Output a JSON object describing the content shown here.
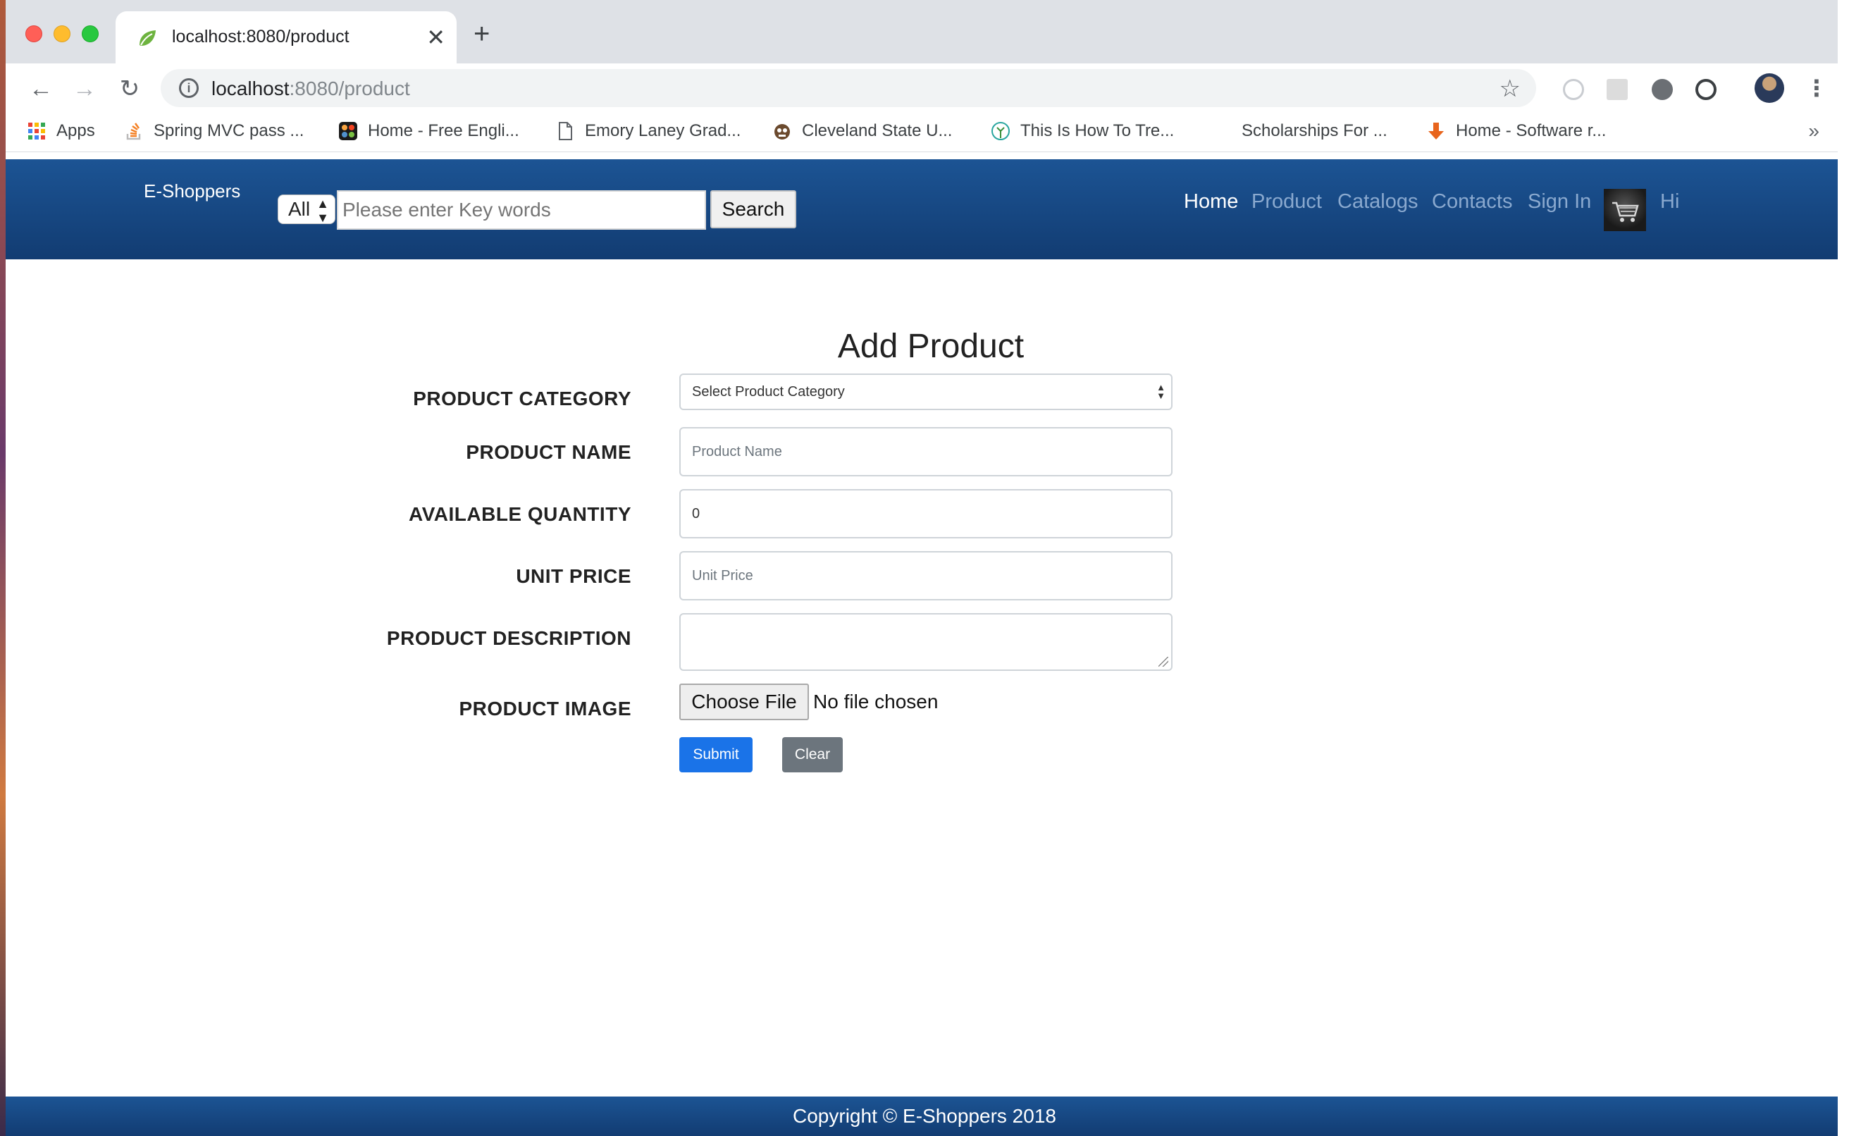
{
  "browser": {
    "tab_title": "localhost:8080/product",
    "url_host": "localhost",
    "url_path": ":8080/product",
    "bookmarks": [
      {
        "label": "Apps",
        "icon": "apps-grid-icon"
      },
      {
        "label": "Spring MVC pass ...",
        "icon": "stackoverflow-icon"
      },
      {
        "label": "Home - Free Engli...",
        "icon": "joomla-icon"
      },
      {
        "label": "Emory Laney Grad...",
        "icon": "document-icon"
      },
      {
        "label": "Cleveland State U...",
        "icon": "mascot-icon"
      },
      {
        "label": "This Is How To Tre...",
        "icon": "tree-icon"
      },
      {
        "label": "Scholarships For ...",
        "icon": ""
      },
      {
        "label": "Home - Software r...",
        "icon": "down-arrow-icon"
      }
    ],
    "bookmarks_more": "»"
  },
  "site": {
    "brand": "E-Shoppers",
    "search_category": "All",
    "search_placeholder": "Please enter Key words",
    "search_button": "Search",
    "nav": [
      "Home",
      "Product",
      "Catalogs",
      "Contacts",
      "Sign In",
      "Hi"
    ]
  },
  "form": {
    "title": "Add Product",
    "category_label": "PRODUCT CATEGORY",
    "category_value": "Select Product Category",
    "name_label": "PRODUCT NAME",
    "name_placeholder": "Product Name",
    "qty_label": "AVAILABLE QUANTITY",
    "qty_value": "0",
    "price_label": "UNIT PRICE",
    "price_placeholder": "Unit Price",
    "desc_label": "PRODUCT DESCRIPTION",
    "image_label": "PRODUCT IMAGE",
    "file_button": "Choose File",
    "file_status": "No file chosen",
    "submit": "Submit",
    "clear": "Clear"
  },
  "footer": {
    "copyright": "Copyright © E-Shoppers 2018"
  },
  "colors": {
    "header_top": "#1c5494",
    "header_bottom": "#123c72",
    "submit": "#1a73e8",
    "clear": "#6c757d"
  }
}
